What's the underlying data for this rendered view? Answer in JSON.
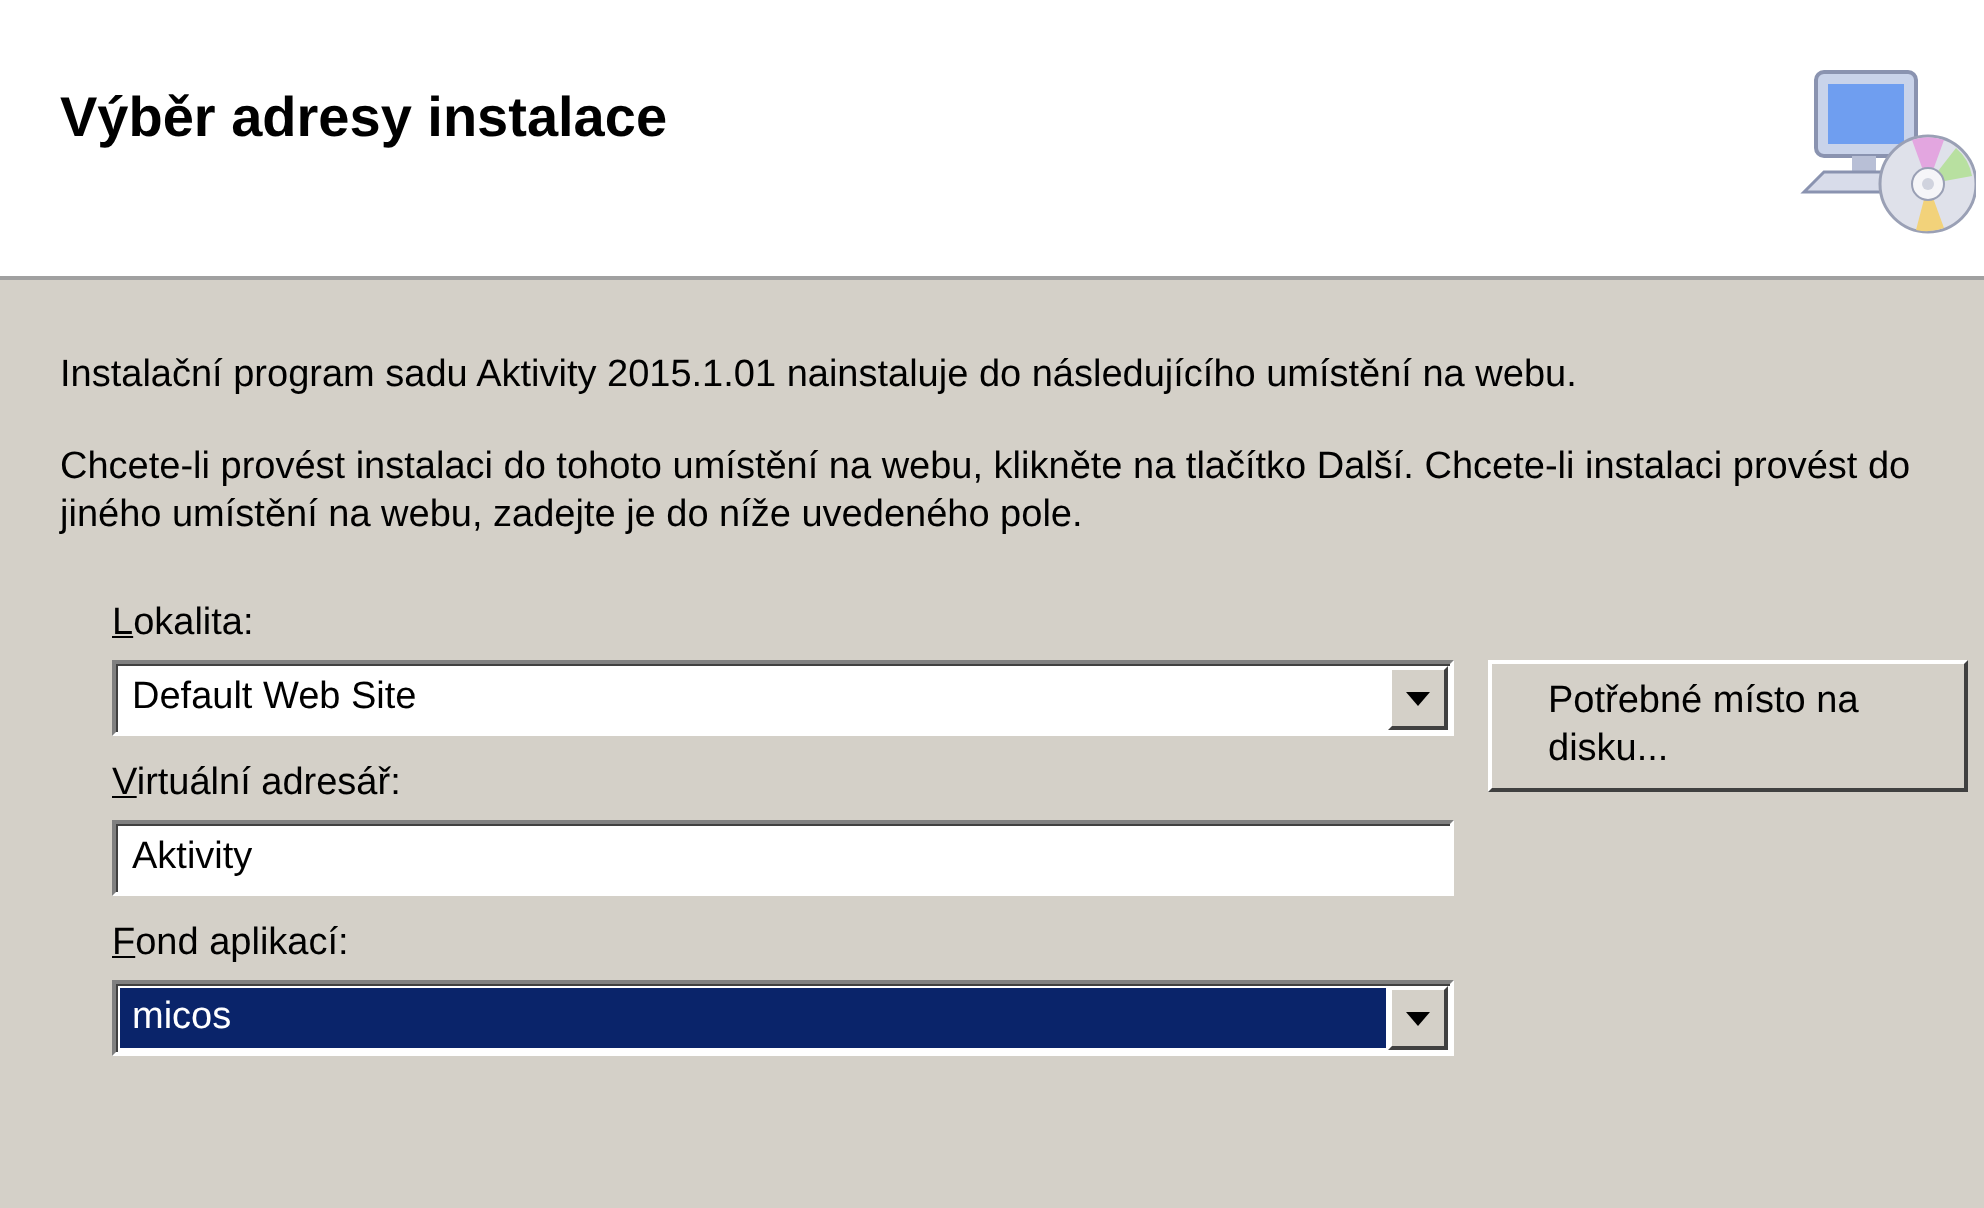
{
  "header": {
    "title": "Výběr adresy instalace"
  },
  "paragraphs": [
    "Instalační program sadu Aktivity 2015.1.01 nainstaluje do následujícího umístění na webu.",
    "Chcete-li provést instalaci do tohoto umístění na webu, klikněte na tlačítko Další. Chcete-li instalaci provést do jiného umístění na webu, zadejte je do níže uvedeného pole."
  ],
  "fields": [
    {
      "kind": "combobox",
      "label": "Lokalita:",
      "mnemonic": true,
      "value": "Default Web Site",
      "selected": false
    },
    {
      "kind": "textbox",
      "label": "Virtuální adresář:",
      "mnemonic": true,
      "value": "Aktivity",
      "selected": false
    },
    {
      "kind": "combobox",
      "label": "Fond aplikací:",
      "mnemonic": true,
      "value": "micos",
      "selected": true
    }
  ],
  "side_button": {
    "label": "Potřebné místo na disku..."
  }
}
